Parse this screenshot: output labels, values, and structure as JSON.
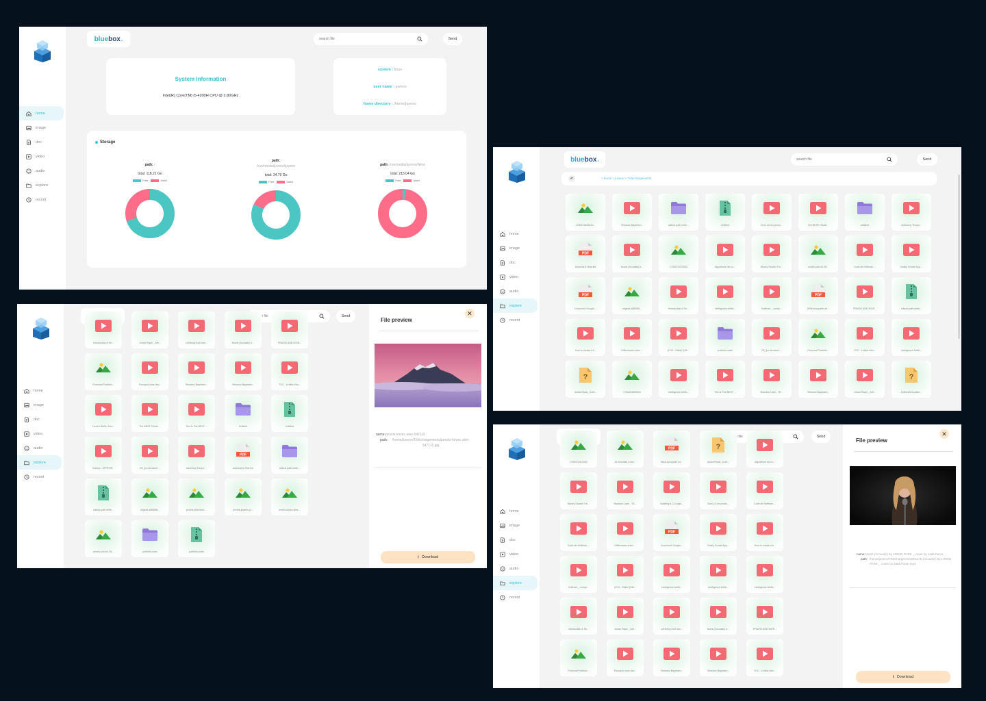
{
  "brand": {
    "part1": "blue",
    "part2": "box",
    "dot": "."
  },
  "nav": [
    "home",
    "image",
    "doc",
    "video",
    "audio",
    "explore",
    "recent"
  ],
  "search": {
    "placeholder": "search file"
  },
  "send_label": "Send",
  "colors": {
    "free": "#4cc6c2",
    "used": "#fd6c88",
    "accent": "#2fc2d9"
  },
  "home": {
    "sysinfo_title": "System Information",
    "cpu": "Intel(R) Core(TM) i5-4200H CPU @ 2.80GHz",
    "system_label": "system :",
    "system_value": "linux",
    "user_label": "user name :",
    "user_value": "juveno",
    "homedir_label": "home directory :",
    "homedir_value": "/home/juveno",
    "storage_title": "Storage",
    "path_label": "path:",
    "legend_free": "Free",
    "legend_used": "Used"
  },
  "chart_data": [
    {
      "type": "pie",
      "path": "/",
      "total": "total: 118.21 Go",
      "labels": [
        "Free",
        "Used"
      ],
      "values": [
        70,
        30
      ]
    },
    {
      "type": "pie",
      "path": "/run/media/juveno/juveno",
      "total": "total: 34.79 Go",
      "labels": [
        "Free",
        "Used"
      ],
      "values": [
        82,
        18
      ]
    },
    {
      "type": "pie",
      "path": "/run/media/juveno/Ninw",
      "total": "total: 215.04 Go",
      "labels": [
        "Free",
        "Used"
      ],
      "values": [
        2,
        98
      ]
    }
  ],
  "explore": {
    "breadcrumb": "> home > juveno > Téléchargements",
    "files": [
      {
        "name": "1706374406433...",
        "icon": "image-icon"
      },
      {
        "name": "Réseaux Bayésien...",
        "icon": "video-icon"
      },
      {
        "name": "critical-path-meth...",
        "icon": "folder-icon"
      },
      {
        "name": "Untitled",
        "icon": "zip-icon"
      },
      {
        "name": "Burn U2 en produ...",
        "icon": "video-icon"
      },
      {
        "name": "The BEST OAuth...",
        "icon": "video-icon"
      },
      {
        "name": "Untitled",
        "icon": "folder-icon"
      },
      {
        "name": "andrunny Tempo...",
        "icon": "video-icon"
      },
      {
        "name": "Automat à l'état fini",
        "icon": "pdf-icon"
      },
      {
        "name": "Numb (Acoustic) b...",
        "icon": "video-icon"
      },
      {
        "name": "1706374472932",
        "icon": "image-icon"
      },
      {
        "name": "Algorithme de co...",
        "icon": "video-icon"
      },
      {
        "name": "Binary Search Tre...",
        "icon": "video-icon"
      },
      {
        "name": "pexels-pok-rie-26...",
        "icon": "image-icon"
      },
      {
        "name": "Code de Huffman ...",
        "icon": "video-icon"
      },
      {
        "name": "Easily Create App...",
        "icon": "video-icon"
      },
      {
        "name": "Document Google...",
        "icon": "pdf-icon"
      },
      {
        "name": "original-a5f0688...",
        "icon": "image-icon"
      },
      {
        "name": "Introduction à Ter...",
        "icon": "video-icon"
      },
      {
        "name": "Intelligence Artific...",
        "icon": "video-icon"
      },
      {
        "name": "Huffman _ compr...",
        "icon": "video-icon"
      },
      {
        "name": "5606 bocquelin ed...",
        "icon": "pdf-icon"
      },
      {
        "name": "PRAISE AND WOR...",
        "icon": "video-icon"
      },
      {
        "name": "critical-path-meth...",
        "icon": "zip-icon"
      },
      {
        "name": "How to create a li...",
        "icon": "video-icon"
      },
      {
        "name": "Différences entre ...",
        "icon": "video-icon"
      },
      {
        "name": "[HY2 - Skillet (Offi...",
        "icon": "video-icon"
      },
      {
        "name": "portfolio-main",
        "icon": "folder-icon"
      },
      {
        "name": "[25_]La structure ...",
        "icon": "video-icon"
      },
      {
        "name": "Personal Portfolio...",
        "icon": "image-icon"
      },
      {
        "name": "TOC - Lehibe Afro...",
        "icon": "video-icon"
      },
      {
        "name": "Intelligence Artific...",
        "icon": "video-icon"
      },
      {
        "name": "AdobeStock_1146...",
        "icon": "unknown-icon"
      },
      {
        "name": "1706424603231",
        "icon": "image-icon"
      },
      {
        "name": "Intelligence Artific...",
        "icon": "video-icon"
      },
      {
        "name": "This is The BEST ...",
        "icon": "video-icon"
      },
      {
        "name": "Brandon Lake - TE...",
        "icon": "video-icon"
      },
      {
        "name": "Réseaux Bayésien...",
        "icon": "video-icon"
      },
      {
        "name": "Johan Raph _ Afri...",
        "icon": "video-icon"
      },
      {
        "name": "1280x1024-patter...",
        "icon": "unknown-icon"
      }
    ]
  },
  "preview_image": {
    "title": "File preview",
    "name_label": "name:",
    "name_value": "pexels-krivec-ales-547115",
    "path_label": "path:",
    "path_value": "/home/juveno/Téléchargements/pexels-krivec-ales-547115.jpg",
    "download": "Download",
    "files": [
      {
        "name": "Introduction à Ter...",
        "icon": "video-icon"
      },
      {
        "name": "Johan Raph _ Afri...",
        "icon": "video-icon"
      },
      {
        "name": "Lehibeny And ram...",
        "icon": "video-icon"
      },
      {
        "name": "Numb (Acoustic) b...",
        "icon": "video-icon"
      },
      {
        "name": "PRAISE AND WOR...",
        "icon": "video-icon"
      },
      {
        "name": "Personal Portfolio...",
        "icon": "image-icon"
      },
      {
        "name": "Pourquoi vous dev...",
        "icon": "video-icon"
      },
      {
        "name": "Réseaux Bayésien...",
        "icon": "video-icon"
      },
      {
        "name": "Réseaux Bayésien...",
        "icon": "video-icon"
      },
      {
        "name": "TOC - Lehibe Afro...",
        "icon": "video-icon"
      },
      {
        "name": "Tauren Wells, Elev...",
        "icon": "video-icon"
      },
      {
        "name": "The BEST OAuth ...",
        "icon": "video-icon"
      },
      {
        "name": "This is The BEST ...",
        "icon": "video-icon"
      },
      {
        "name": "Untitled",
        "icon": "folder-icon"
      },
      {
        "name": "Untitled",
        "icon": "zip-icon"
      },
      {
        "name": "Yoshua - UPPERR...",
        "icon": "video-icon"
      },
      {
        "name": "[25_]La structure ...",
        "icon": "video-icon"
      },
      {
        "name": "andrunny Tempo ...",
        "icon": "video-icon"
      },
      {
        "name": "automat à l'état fini",
        "icon": "pdf-icon"
      },
      {
        "name": "critical-path-meth...",
        "icon": "folder-icon"
      },
      {
        "name": "critical-path-meth...",
        "icon": "zip-icon"
      },
      {
        "name": "original-a5f0688...",
        "icon": "image-icon"
      },
      {
        "name": "pexels-eberhard-...",
        "icon": "image-icon"
      },
      {
        "name": "pexels-jeyakin-ju...",
        "icon": "image-icon"
      },
      {
        "name": "pexels-krivec-ales-...",
        "icon": "image-icon"
      },
      {
        "name": "pexels-pok-rie-26...",
        "icon": "image-icon"
      },
      {
        "name": "portfolio-main",
        "icon": "folder-icon"
      },
      {
        "name": "portfolio-main",
        "icon": "zip-icon"
      }
    ]
  },
  "preview_video": {
    "title": "File preview",
    "name_label": "name:",
    "name_value": "Numb (Acoustic) by LINKIN PARK _ cover by Jada Facer",
    "path_label": "path:",
    "path_value": "/home/juveno/Téléchargements/Numb (Acoustic) by LINKIN PARK _ cover by Jada Facer.mp4",
    "download": "Download",
    "files": [
      {
        "name": "1706374472932",
        "icon": "image-icon"
      },
      {
        "name": "43 Beautiful Color...",
        "icon": "image-icon"
      },
      {
        "name": "5606 bocquelin ed...",
        "icon": "pdf-icon"
      },
      {
        "name": "AdobeStock_1146...",
        "icon": "unknown-icon"
      },
      {
        "name": "Algorithme de co...",
        "icon": "video-icon"
      },
      {
        "name": "Binary Search Tre...",
        "icon": "video-icon"
      },
      {
        "name": "Brandon Lake - TE...",
        "icon": "video-icon"
      },
      {
        "name": "Building a CLI appl...",
        "icon": "video-icon"
      },
      {
        "name": "Burn U2 en produ...",
        "icon": "video-icon"
      },
      {
        "name": "Code de Huffman ...",
        "icon": "video-icon"
      },
      {
        "name": "Code de Huffman ...",
        "icon": "video-icon"
      },
      {
        "name": "Différences entre ...",
        "icon": "video-icon"
      },
      {
        "name": "Document Google...",
        "icon": "pdf-icon"
      },
      {
        "name": "Easily Create App...",
        "icon": "video-icon"
      },
      {
        "name": "How to create a li...",
        "icon": "video-icon"
      },
      {
        "name": "Huffman _ compr...",
        "icon": "video-icon"
      },
      {
        "name": "[HY2 - Skillet (Offi...",
        "icon": "video-icon"
      },
      {
        "name": "Intelligence Artific...",
        "icon": "video-icon"
      },
      {
        "name": "Intelligence Artific...",
        "icon": "video-icon"
      },
      {
        "name": "Intelligence Artific...",
        "icon": "video-icon"
      },
      {
        "name": "Introduction à Ter...",
        "icon": "video-icon"
      },
      {
        "name": "Johan Raph _ Afri...",
        "icon": "video-icon"
      },
      {
        "name": "Lehibeny And ram...",
        "icon": "video-icon"
      },
      {
        "name": "Numb (Acoustic) b...",
        "icon": "video-icon"
      },
      {
        "name": "PRAISE AND WOR...",
        "icon": "video-icon"
      },
      {
        "name": "Personal Portfolio...",
        "icon": "image-icon"
      },
      {
        "name": "Pourquoi vous dev...",
        "icon": "video-icon"
      },
      {
        "name": "Réseaux Bayésien...",
        "icon": "video-icon"
      },
      {
        "name": "Réseaux Bayésien...",
        "icon": "video-icon"
      },
      {
        "name": "TOC - Lehibe Afro...",
        "icon": "video-icon"
      }
    ]
  }
}
